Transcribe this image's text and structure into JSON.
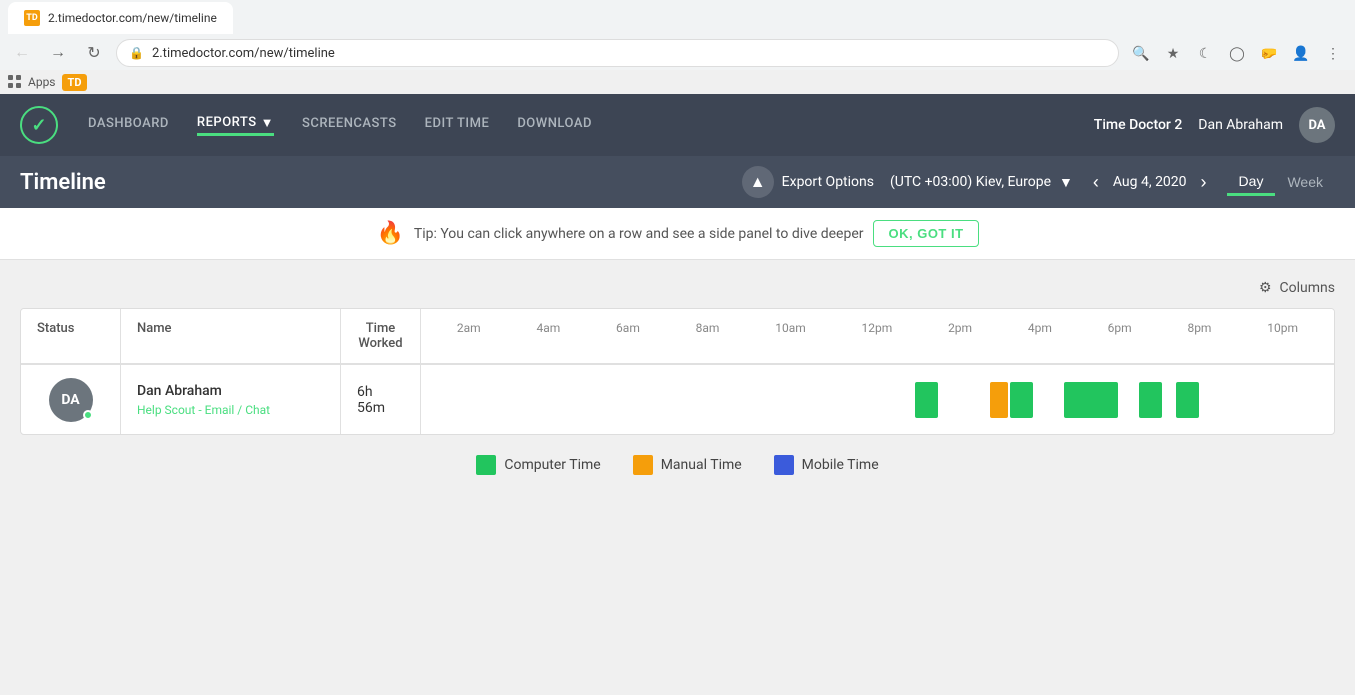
{
  "browser": {
    "url": "2.timedoctor.com/new/timeline",
    "tab_label": "TD",
    "apps_label": "Apps"
  },
  "header": {
    "nav": {
      "dashboard": "DASHBOARD",
      "reports": "REPORTS",
      "screencasts": "SCREENCASTS",
      "edit_time": "EDIT TIME",
      "download": "DOWNLOAD"
    },
    "app_name": "Time Doctor 2",
    "user_name": "Dan Abraham",
    "avatar_initials": "DA"
  },
  "timeline": {
    "title": "Timeline",
    "export_label": "Export Options",
    "timezone": "(UTC +03:00) Kiev, Europe",
    "date": "Aug 4, 2020",
    "view_day": "Day",
    "view_week": "Week"
  },
  "tip": {
    "text": "Tip: You can click anywhere on a row and see a side panel to dive deeper",
    "button": "OK, GOT IT"
  },
  "columns_btn": "Columns",
  "table": {
    "headers": {
      "status": "Status",
      "name": "Name",
      "time_worked": "Time Worked"
    },
    "time_labels": [
      "2am",
      "4am",
      "6am",
      "8am",
      "10am",
      "12pm",
      "2pm",
      "4pm",
      "6pm",
      "8pm",
      "10pm"
    ],
    "rows": [
      {
        "avatar_initials": "DA",
        "name": "Dan Abraham",
        "task": "Help Scout - Email / Chat",
        "time_worked": "6h 56m"
      }
    ]
  },
  "legend": {
    "computer_time": "Computer Time",
    "manual_time": "Manual Time",
    "mobile_time": "Mobile Time",
    "colors": {
      "computer": "#22c55e",
      "manual": "#f59e0b",
      "mobile": "#3b5bdb"
    }
  }
}
